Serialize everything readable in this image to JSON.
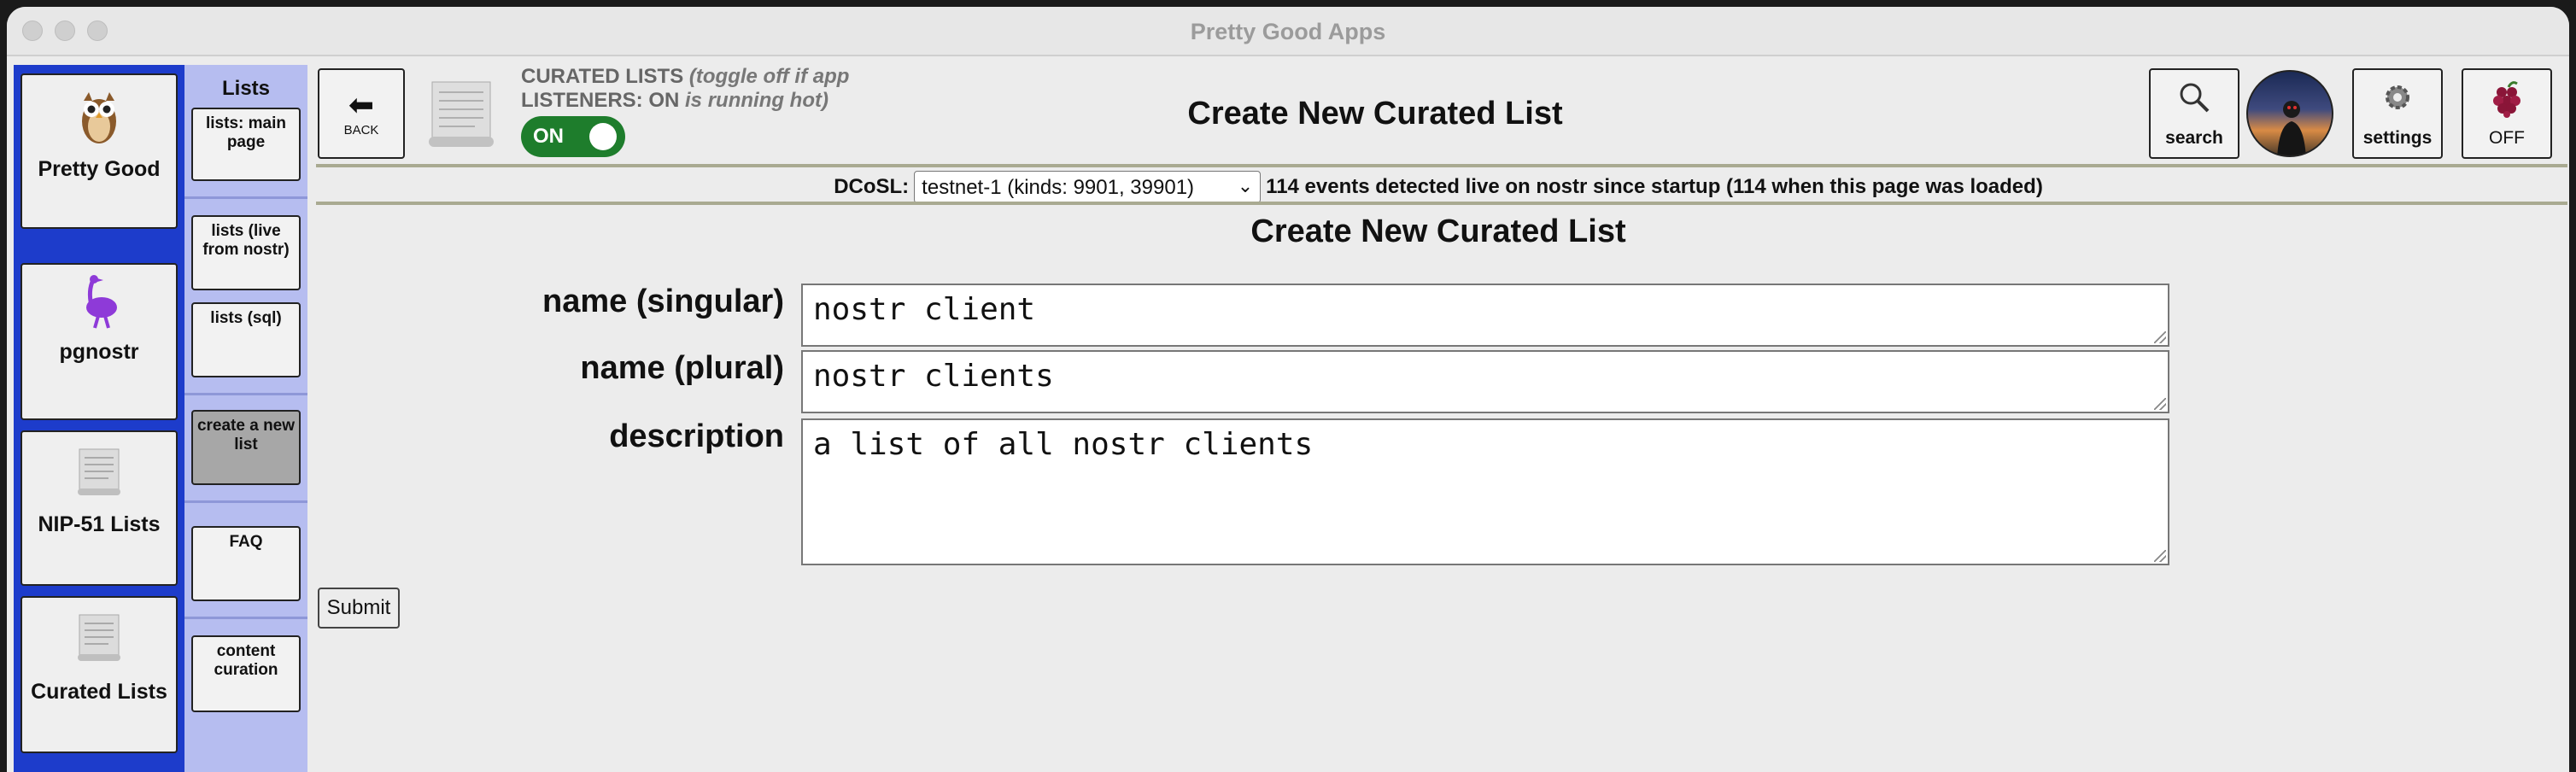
{
  "window": {
    "title": "Pretty Good Apps"
  },
  "apps": [
    {
      "label": "Pretty Good",
      "icon": "owl-icon"
    },
    {
      "label": "pgnostr",
      "icon": "ostrich-icon"
    },
    {
      "label": "NIP-51 Lists",
      "icon": "scroll-icon"
    },
    {
      "label": "Curated Lists",
      "icon": "scroll-icon"
    }
  ],
  "subnav": {
    "title": "Lists",
    "items": [
      {
        "label": "lists: main page"
      },
      {
        "label": "lists (live from nostr)"
      },
      {
        "label": "lists (sql)"
      },
      {
        "label": "create a new list",
        "active": true
      },
      {
        "label": "FAQ"
      },
      {
        "label": "content curation"
      }
    ]
  },
  "header": {
    "back_label": "BACK",
    "listeners_line1": "CURATED LISTS",
    "listeners_line1_note": "(toggle off if app",
    "listeners_line2": "LISTENERS: ON",
    "listeners_line2_note": "is running hot)",
    "toggle_label": "ON",
    "page_title": "Create New Curated List",
    "search_label": "search",
    "settings_label": "settings",
    "off_label": "OFF"
  },
  "dcosl": {
    "label": "DCoSL:",
    "selected": "testnet-1 (kinds: 9901, 39901)",
    "status": "114 events detected live on nostr since startup (114 when this page was loaded)"
  },
  "form": {
    "title": "Create New Curated List",
    "name_singular_label": "name (singular)",
    "name_singular_value": "nostr client",
    "name_plural_label": "name (plural)",
    "name_plural_value": "nostr clients",
    "description_label": "description",
    "description_value": "a list of all nostr clients",
    "submit_label": "Submit"
  },
  "colors": {
    "app_sidebar": "#1d3ccb",
    "sub_sidebar": "#b6bdf0",
    "toggle_on": "#1e7d2c",
    "active_subnav": "#a7a7a7"
  }
}
